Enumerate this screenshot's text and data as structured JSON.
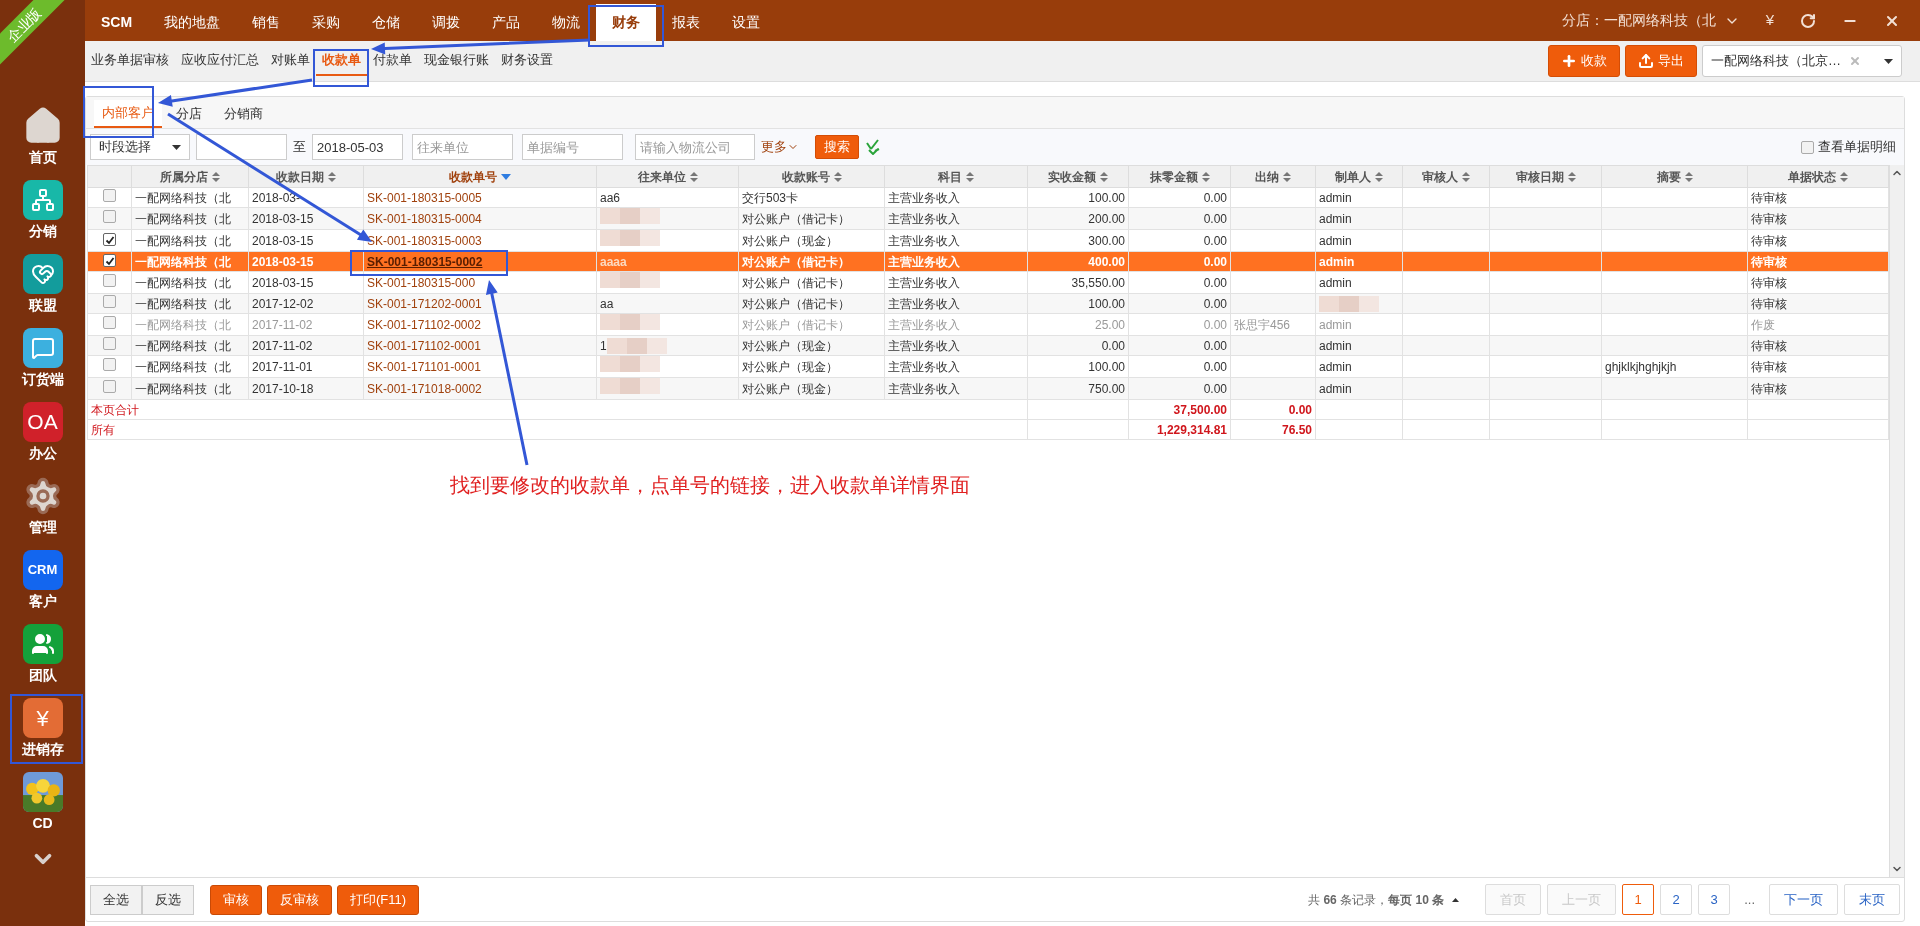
{
  "edition_ribbon": "企业版",
  "sidebar": {
    "items": [
      {
        "kind": "home",
        "label": "首页"
      },
      {
        "kind": "distribution",
        "label": "分销"
      },
      {
        "kind": "alliance",
        "label": "联盟"
      },
      {
        "kind": "ordering",
        "label": "订货端"
      },
      {
        "kind": "oa",
        "label": "办公",
        "badge_text": "OA"
      },
      {
        "kind": "settings",
        "label": "管理"
      },
      {
        "kind": "crm",
        "label": "客户",
        "badge_text": "CRM"
      },
      {
        "kind": "team",
        "label": "团队"
      },
      {
        "kind": "inventory",
        "label": "进销存",
        "badge_text": "¥"
      },
      {
        "kind": "picture",
        "label": "CD"
      }
    ]
  },
  "top_nav": {
    "items": [
      {
        "label": "SCM",
        "selected": false
      },
      {
        "label": "我的地盘",
        "selected": false
      },
      {
        "label": "销售",
        "selected": false
      },
      {
        "label": "采购",
        "selected": false
      },
      {
        "label": "仓储",
        "selected": false
      },
      {
        "label": "调拨",
        "selected": false
      },
      {
        "label": "产品",
        "selected": false
      },
      {
        "label": "物流",
        "selected": false
      },
      {
        "label": "财务",
        "selected": true
      },
      {
        "label": "报表",
        "selected": false
      },
      {
        "label": "设置",
        "selected": false
      }
    ],
    "branch": "分店：一配网络科技（北",
    "currency": "¥"
  },
  "sub_nav": {
    "items": [
      {
        "label": "业务单据审核",
        "selected": false
      },
      {
        "label": "应收应付汇总",
        "selected": false
      },
      {
        "label": "对账单",
        "selected": false
      },
      {
        "label": "收款单",
        "selected": true
      },
      {
        "label": "付款单",
        "selected": false
      },
      {
        "label": "现金银行账",
        "selected": false
      },
      {
        "label": "财务设置",
        "selected": false
      }
    ],
    "actions": [
      {
        "label": "收款",
        "kind": "add"
      },
      {
        "label": "导出",
        "kind": "export"
      }
    ],
    "company_select": "一配网络科技（北京…"
  },
  "tabs": [
    {
      "label": "内部客户",
      "selected": true
    },
    {
      "label": "分店",
      "selected": false
    },
    {
      "label": "分销商",
      "selected": false
    }
  ],
  "filter": {
    "period_select": "时段选择",
    "separator": "至",
    "date_to": "2018-05-03",
    "placeholders": [
      "往来单位",
      "单据编号",
      "请输入物流公司"
    ],
    "more": "更多",
    "search": "搜索",
    "detail_checkbox": {
      "label": "查看单据明细",
      "checked": false
    }
  },
  "table": {
    "columns": [
      {
        "label": "所属分店",
        "sorted": false
      },
      {
        "label": "收款日期",
        "sorted": false
      },
      {
        "label": "收款单号",
        "sorted": true
      },
      {
        "label": "往来单位",
        "sorted": false
      },
      {
        "label": "收款账号",
        "sorted": false
      },
      {
        "label": "科目",
        "sorted": false
      },
      {
        "label": "实收金额",
        "sorted": false
      },
      {
        "label": "抹零金额",
        "sorted": false
      },
      {
        "label": "出纳",
        "sorted": false
      },
      {
        "label": "制单人",
        "sorted": false
      },
      {
        "label": "审核人",
        "sorted": false
      },
      {
        "label": "审核日期",
        "sorted": false
      },
      {
        "label": "摘要",
        "sorted": false
      },
      {
        "label": "单据状态",
        "sorted": false
      }
    ],
    "rows": [
      {
        "checked": false,
        "selected": false,
        "voided": false,
        "branch": "一配网络科技（北",
        "date": "2018-03-",
        "number": "SK-001-180315-0005",
        "unit": "aa6",
        "unit_blurred": false,
        "account": "交行503卡",
        "subject": "主营业务收入",
        "amount": "100.00",
        "rounding": "0.00",
        "maker": "admin",
        "maker_blurred": false,
        "status": "待审核"
      },
      {
        "checked": false,
        "selected": false,
        "voided": false,
        "branch": "一配网络科技（北",
        "date": "2018-03-15",
        "number": "SK-001-180315-0004",
        "unit_blurred": true,
        "account": "对公账户（借记卡）",
        "subject": "主营业务收入",
        "amount": "200.00",
        "rounding": "0.00",
        "maker": "admin",
        "maker_blurred": false,
        "status": "待审核"
      },
      {
        "checked": true,
        "selected": false,
        "voided": false,
        "branch": "一配网络科技（北",
        "date": "2018-03-15",
        "number": "SK-001-180315-0003",
        "unit_blurred": true,
        "account": "对公账户（现金）",
        "subject": "主营业务收入",
        "amount": "300.00",
        "rounding": "0.00",
        "maker": "admin",
        "maker_blurred": false,
        "status": "待审核"
      },
      {
        "checked": true,
        "selected": true,
        "voided": false,
        "branch": "一配网络科技（北",
        "date": "2018-03-15",
        "number": "SK-001-180315-0002",
        "unit": "aaaa",
        "unit_blurred": false,
        "account": "对公账户（借记卡）",
        "subject": "主营业务收入",
        "amount": "400.00",
        "rounding": "0.00",
        "maker": "admin",
        "maker_blurred": false,
        "status": "待审核"
      },
      {
        "checked": false,
        "selected": false,
        "voided": false,
        "branch": "一配网络科技（北",
        "date": "2018-03-15",
        "number": "SK-001-180315-000",
        "unit_blurred": true,
        "account": "对公账户（借记卡）",
        "subject": "主营业务收入",
        "amount": "35,550.00",
        "rounding": "0.00",
        "maker": "admin",
        "maker_blurred": false,
        "status": "待审核"
      },
      {
        "checked": false,
        "selected": false,
        "voided": false,
        "branch": "一配网络科技（北",
        "date": "2017-12-02",
        "number": "SK-001-171202-0001",
        "unit": "aa",
        "unit_blurred": false,
        "account": "对公账户（借记卡）",
        "subject": "主营业务收入",
        "amount": "100.00",
        "rounding": "0.00",
        "maker_blurred": true,
        "status": "待审核"
      },
      {
        "checked": false,
        "selected": false,
        "voided": true,
        "branch": "一配网络科技（北",
        "date": "2017-11-02",
        "number": "SK-001-171102-0002",
        "unit_blurred": true,
        "account": "对公账户（借记卡）",
        "subject": "主营业务收入",
        "amount": "25.00",
        "rounding": "0.00",
        "cashier": "张思宇456",
        "maker": "admin",
        "maker_blurred": false,
        "status": "作废"
      },
      {
        "checked": false,
        "selected": false,
        "voided": false,
        "branch": "一配网络科技（北",
        "date": "2017-11-02",
        "number": "SK-001-171102-0001",
        "unit": "1",
        "unit_blurred": true,
        "account": "对公账户（现金）",
        "subject": "主营业务收入",
        "amount": "0.00",
        "rounding": "0.00",
        "maker": "admin",
        "maker_blurred": false,
        "status": "待审核"
      },
      {
        "checked": false,
        "selected": false,
        "voided": false,
        "branch": "一配网络科技（北",
        "date": "2017-11-01",
        "number": "SK-001-171101-0001",
        "unit_blurred": true,
        "account": "对公账户（现金）",
        "subject": "主营业务收入",
        "amount": "100.00",
        "rounding": "0.00",
        "maker": "admin",
        "maker_blurred": false,
        "summary": "ghjklkjhghjkjh",
        "status": "待审核"
      },
      {
        "checked": false,
        "selected": false,
        "voided": false,
        "branch": "一配网络科技（北",
        "date": "2017-10-18",
        "number": "SK-001-171018-0002",
        "unit_blurred": true,
        "account": "对公账户（现金）",
        "subject": "主营业务收入",
        "amount": "750.00",
        "rounding": "0.00",
        "maker": "admin",
        "maker_blurred": false,
        "status": "待审核"
      }
    ],
    "totals": [
      {
        "label": "本页合计",
        "amount": "37,500.00",
        "rounding": "0.00"
      },
      {
        "label": "所有",
        "amount": "1,229,314.81",
        "rounding": "76.50"
      }
    ]
  },
  "footer": {
    "buttons": [
      {
        "label": "全选",
        "kind": "plain"
      },
      {
        "label": "反选",
        "kind": "plain"
      },
      {
        "label": "审核",
        "kind": "primary"
      },
      {
        "label": "反审核",
        "kind": "primary"
      },
      {
        "label": "打印(F11)",
        "kind": "primary"
      }
    ],
    "summary": "共 **66** 条记录，**每页 10 条**",
    "pages": [
      {
        "label": "首页",
        "kind": "nav",
        "disabled": true,
        "selected": false
      },
      {
        "label": "上一页",
        "kind": "nav",
        "disabled": true,
        "selected": false
      },
      {
        "label": "1",
        "kind": "page",
        "disabled": false,
        "selected": true
      },
      {
        "label": "2",
        "kind": "page",
        "disabled": false,
        "selected": false
      },
      {
        "label": "3",
        "kind": "page",
        "disabled": false,
        "selected": false
      },
      {
        "label": "...",
        "kind": "gap"
      },
      {
        "label": "下一页",
        "kind": "nav",
        "disabled": false,
        "selected": false
      },
      {
        "label": "末页",
        "kind": "nav",
        "disabled": false,
        "selected": false
      }
    ]
  },
  "annotation": {
    "note": "找到要修改的收款单，点单号的链接，进入收款单详情界面"
  }
}
